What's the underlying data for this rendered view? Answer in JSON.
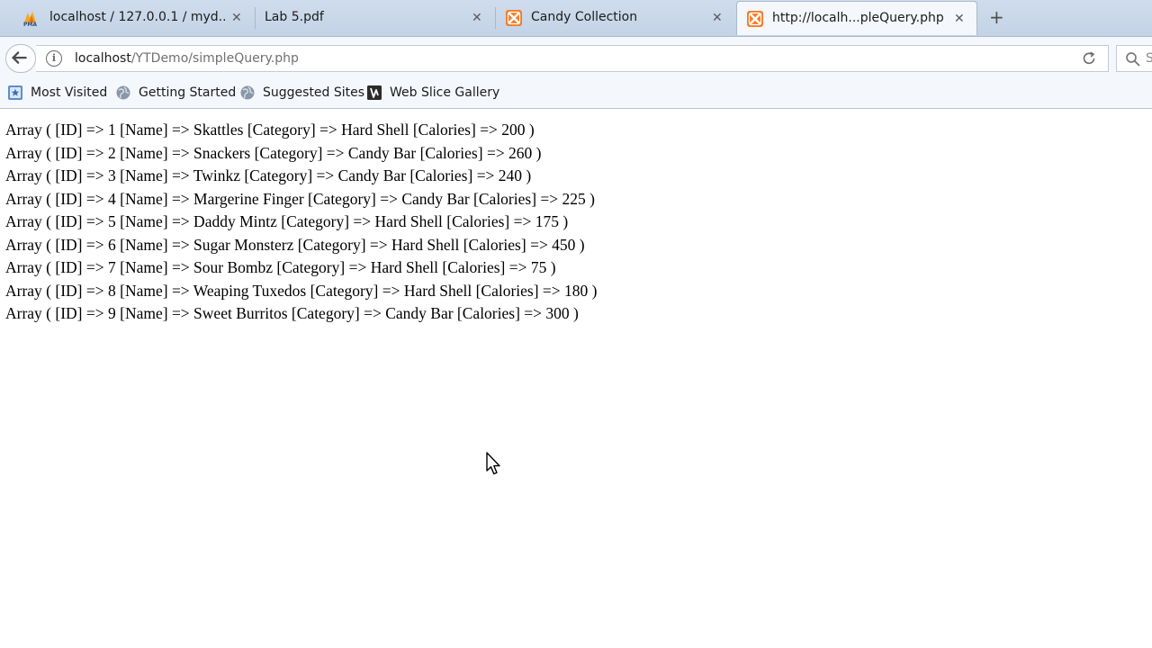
{
  "tabs": [
    {
      "label": "localhost / 127.0.0.1 / myd...",
      "icon": "phpmyadmin-icon",
      "active": false
    },
    {
      "label": "Lab 5.pdf",
      "icon": "none",
      "active": false
    },
    {
      "label": "Candy Collection",
      "icon": "xampp-icon",
      "active": false
    },
    {
      "label": "http://localh...pleQuery.php",
      "icon": "xampp-icon",
      "active": true
    }
  ],
  "close_glyph": "✕",
  "new_tab_glyph": "+",
  "address": {
    "host": "localhost",
    "path": "/YTDemo/simpleQuery.php"
  },
  "search": {
    "placeholder": "S"
  },
  "bookmarks": [
    {
      "label": "Most Visited",
      "icon": "bookmark-star-icon"
    },
    {
      "label": "Getting Started",
      "icon": "globe-icon"
    },
    {
      "label": "Suggested Sites",
      "icon": "globe-icon"
    },
    {
      "label": "Web Slice Gallery",
      "icon": "web-slice-icon"
    }
  ],
  "rows": [
    "Array ( [ID] => 1 [Name] => Skattles [Category] => Hard Shell [Calories] => 200 )",
    "Array ( [ID] => 2 [Name] => Snackers [Category] => Candy Bar [Calories] => 260 )",
    "Array ( [ID] => 3 [Name] => Twinkz [Category] => Candy Bar [Calories] => 240 )",
    "Array ( [ID] => 4 [Name] => Margerine Finger [Category] => Candy Bar [Calories] => 225 )",
    "Array ( [ID] => 5 [Name] => Daddy Mintz [Category] => Hard Shell [Calories] => 175 )",
    "Array ( [ID] => 6 [Name] => Sugar Monsterz [Category] => Hard Shell [Calories] => 450 )",
    "Array ( [ID] => 7 [Name] => Sour Bombz [Category] => Hard Shell [Calories] => 75 )",
    "Array ( [ID] => 8 [Name] => Weaping Tuxedos [Category] => Hard Shell [Calories] => 180 )",
    "Array ( [ID] => 9 [Name] => Sweet Burritos [Category] => Candy Bar [Calories] => 300 )"
  ]
}
